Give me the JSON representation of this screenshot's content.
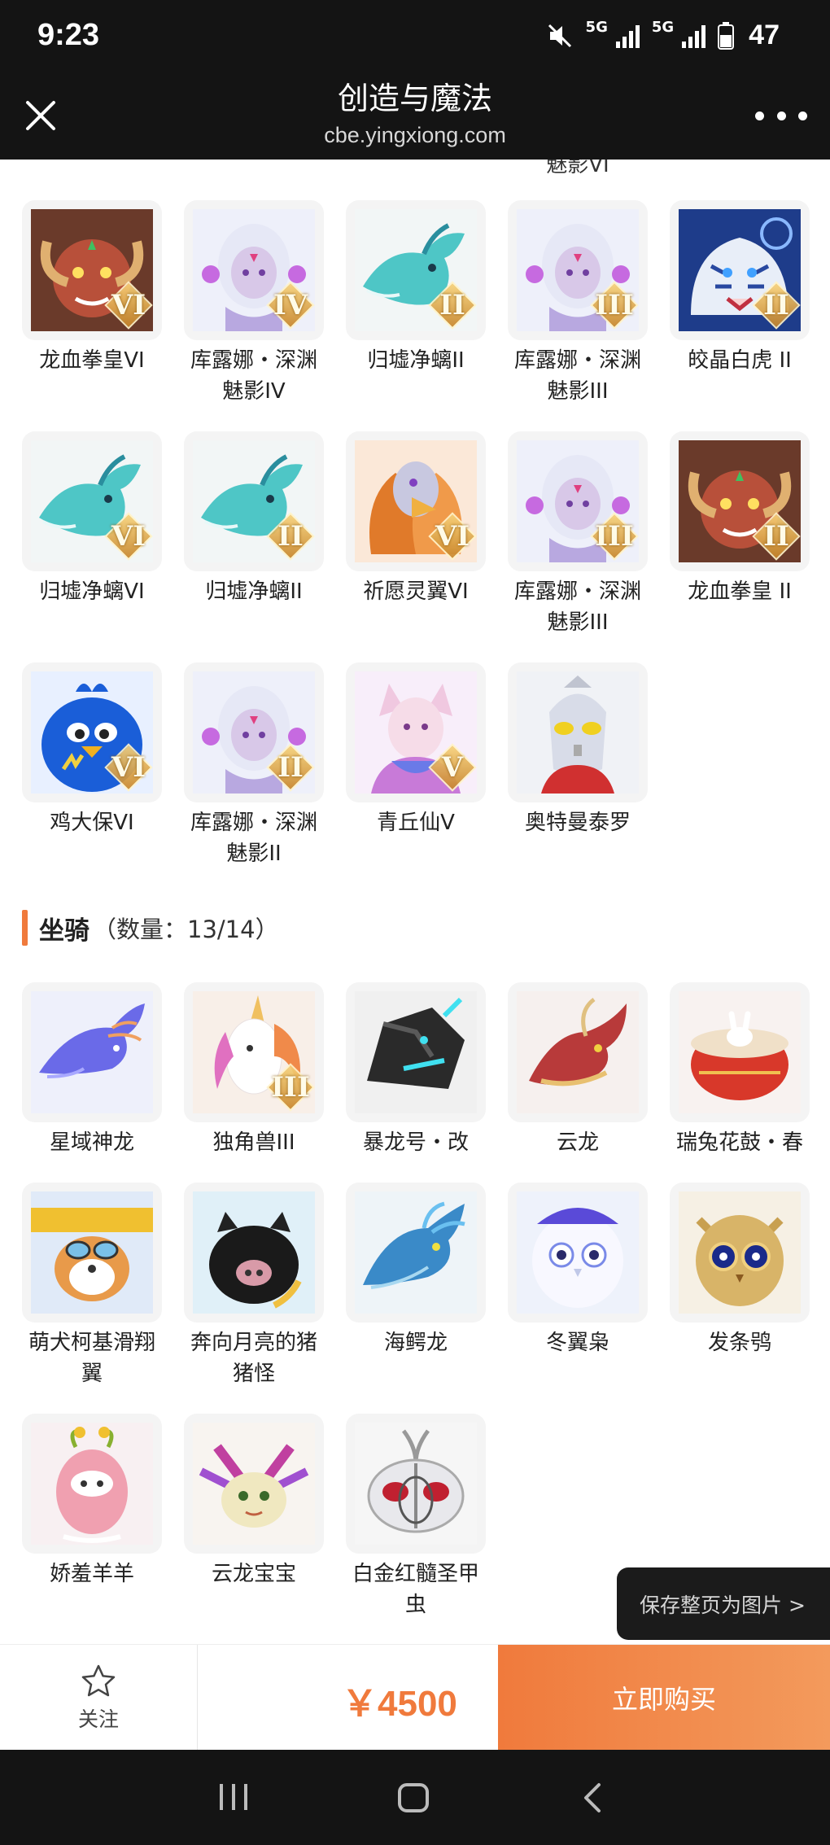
{
  "status": {
    "time": "9:23",
    "net1": "5G",
    "net2": "5G",
    "battery": "47"
  },
  "header": {
    "title": "创造与魔法",
    "url": "cbe.yingxiong.com"
  },
  "pets_cut_label": "魅影VI",
  "pets": [
    {
      "name": "龙血拳皇VI",
      "tier": "VI",
      "icon": "red-ram-beast"
    },
    {
      "name": "库露娜・深渊魅影IV",
      "tier": "IV",
      "icon": "white-haired-girl"
    },
    {
      "name": "归墟净螭II",
      "tier": "II",
      "icon": "teal-dragon"
    },
    {
      "name": "库露娜・深渊魅影III",
      "tier": "III",
      "icon": "white-haired-girl"
    },
    {
      "name": "皎晶白虎 II",
      "tier": "II",
      "icon": "white-tiger"
    },
    {
      "name": "归墟净螭VI",
      "tier": "VI",
      "icon": "teal-dragon"
    },
    {
      "name": "归墟净螭II",
      "tier": "II",
      "icon": "teal-dragon"
    },
    {
      "name": "祈愿灵翼VI",
      "tier": "VI",
      "icon": "griffin"
    },
    {
      "name": "库露娜・深渊魅影III",
      "tier": "III",
      "icon": "white-haired-girl"
    },
    {
      "name": "龙血拳皇 II",
      "tier": "II",
      "icon": "red-ram-beast"
    },
    {
      "name": "鸡大保VI",
      "tier": "VI",
      "icon": "blue-bird"
    },
    {
      "name": "库露娜・深渊魅影II",
      "tier": "II",
      "icon": "white-haired-girl"
    },
    {
      "name": "青丘仙V",
      "tier": "V",
      "icon": "fox-fairy"
    },
    {
      "name": "奥特曼泰罗",
      "tier": "",
      "icon": "ultraman"
    }
  ],
  "mounts_section": {
    "title": "坐骑",
    "count": "（数量：13/14）"
  },
  "mounts": [
    {
      "name": "星域神龙",
      "tier": "",
      "icon": "star-dragon"
    },
    {
      "name": "独角兽III",
      "tier": "III",
      "icon": "unicorn"
    },
    {
      "name": "暴龙号・改",
      "tier": "",
      "icon": "mech-dino"
    },
    {
      "name": "云龙",
      "tier": "",
      "icon": "cloud-dragon"
    },
    {
      "name": "瑞兔花鼓・春",
      "tier": "",
      "icon": "rabbit-drum"
    },
    {
      "name": "萌犬柯基滑翔翼",
      "tier": "",
      "icon": "corgi-glider"
    },
    {
      "name": "奔向月亮的猪猪怪",
      "tier": "",
      "icon": "moon-pig"
    },
    {
      "name": "海鳄龙",
      "tier": "",
      "icon": "sea-dragon"
    },
    {
      "name": "冬翼枭",
      "tier": "",
      "icon": "winter-owl"
    },
    {
      "name": "发条鸮",
      "tier": "",
      "icon": "clockwork-owl"
    },
    {
      "name": "娇羞羊羊",
      "tier": "",
      "icon": "pink-sheep"
    },
    {
      "name": "云龙宝宝",
      "tier": "",
      "icon": "baby-cloud-dragon"
    },
    {
      "name": "白金红髓圣甲虫",
      "tier": "",
      "icon": "platinum-beetle"
    }
  ],
  "save_float": "保存整页为图片 >",
  "bottom": {
    "follow": "关注",
    "price": "￥4500",
    "buy": "立即购买"
  },
  "colors": {
    "accent": "#f07a3c",
    "dark": "#141414"
  }
}
